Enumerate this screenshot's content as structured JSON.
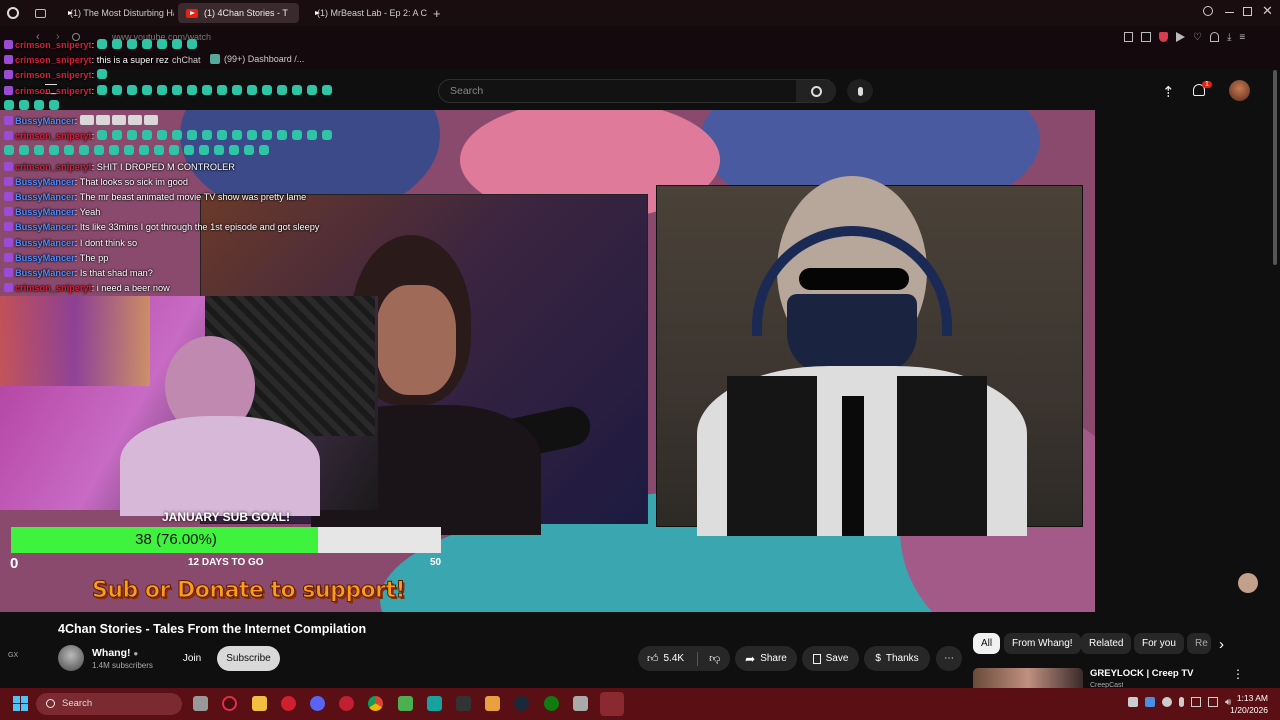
{
  "browser": {
    "tabs": [
      {
        "label": "(1) The Most Disturbing Ha"
      },
      {
        "label": "(1) 4Chan Stories - T"
      },
      {
        "label": "(1) MrBeast Lab - Ep 2: A C"
      }
    ],
    "url": "www.youtube.com/watch",
    "bookmarks": [
      {
        "label": "chChat"
      },
      {
        "label": "(99+) Dashboard /..."
      }
    ]
  },
  "youtube": {
    "search_placeholder": "Search",
    "notification_count": "1"
  },
  "chat": [
    {
      "user": "crimson_sniperyt",
      "color": "red",
      "text": "",
      "emotes": 7
    },
    {
      "user": "crimson_sniperyt",
      "color": "red",
      "text": "this is a super rez",
      "emotes": 0
    },
    {
      "user": "crimson_sniperyt",
      "color": "red",
      "text": "",
      "emotes": 1
    },
    {
      "user": "crimson_sniperyt",
      "color": "red",
      "text": "",
      "emotes": 16
    },
    {
      "user": "",
      "color": "",
      "text": "",
      "emotes": 4
    },
    {
      "user": "BussyMancer",
      "color": "blue",
      "text": "",
      "emotes": 0,
      "white_emotes": 5
    },
    {
      "user": "crimson_sniperyt",
      "color": "red",
      "text": "",
      "emotes": 16
    },
    {
      "user": "",
      "color": "",
      "text": "",
      "emotes": 18
    },
    {
      "user": "crimson_sniperyt",
      "color": "red",
      "text": "SHIT I DROPED M CONTROLER",
      "emotes": 0
    },
    {
      "user": "BussyMancer",
      "color": "blue",
      "text": "That looks so sick im good",
      "emotes": 0
    },
    {
      "user": "BussyMancer",
      "color": "blue",
      "text": "The mr beast animated movie TV show was pretty lame",
      "emotes": 0
    },
    {
      "user": "BussyMancer",
      "color": "blue",
      "text": "Yeah",
      "emotes": 0
    },
    {
      "user": "BussyMancer",
      "color": "blue",
      "text": "Its like 33mins I got through the 1st episode and got sleepy",
      "emotes": 0
    },
    {
      "user": "BussyMancer",
      "color": "blue",
      "text": "I dont think so",
      "emotes": 0
    },
    {
      "user": "BussyMancer",
      "color": "blue",
      "text": "The pp",
      "emotes": 0
    },
    {
      "user": "BussyMancer",
      "color": "blue",
      "text": "Is that shad man?",
      "emotes": 0
    },
    {
      "user": "crimson_sniperyt",
      "color": "red",
      "text": "i need a beer now",
      "emotes": 0
    }
  ],
  "overlay": {
    "goal_title": "JANUARY SUB GOAL!",
    "goal_text": "38 (76.00%)",
    "goal_fraction": 0.76,
    "goal_min": "0",
    "goal_max": "50",
    "goal_days": "12 DAYS TO GO",
    "support": "Sub or Donate to support!"
  },
  "video": {
    "title": "4Chan Stories - Tales From the Internet Compilation",
    "channel": "Whang!",
    "subscribers": "1.4M subscribers",
    "join": "Join",
    "subscribe": "Subscribe",
    "likes": "5.4K",
    "share": "Share",
    "save": "Save",
    "thanks": "Thanks"
  },
  "chips": [
    "All",
    "From Whang!",
    "Related",
    "For you",
    "Re"
  ],
  "recommended": {
    "title": "GREYLOCK | Creep TV",
    "channel": "CreepCast"
  },
  "side_label": "GX",
  "taskbar": {
    "search": "Search",
    "time": "1:13 AM",
    "date": "1/20/2026"
  },
  "colors": {
    "accent": "#e62117",
    "goal_fill": "#3ef23e",
    "taskbar": "#5a0f14",
    "chat_red": "#d1203a",
    "chat_blue": "#4d8cff"
  }
}
